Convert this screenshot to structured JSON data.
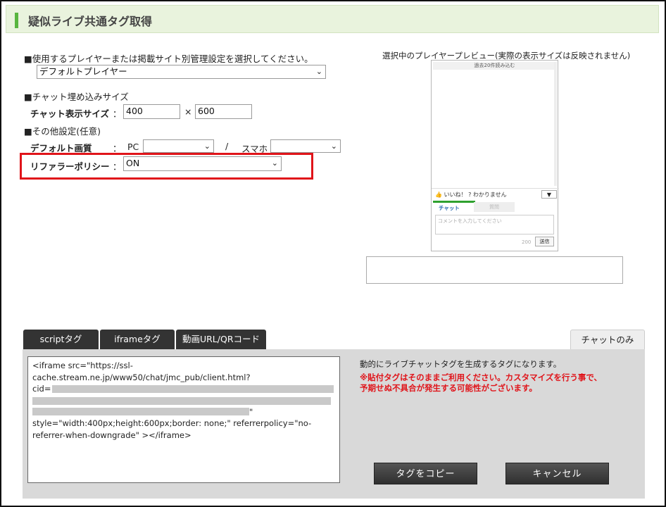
{
  "header": {
    "title": "疑似ライブ共通タグ取得"
  },
  "settings": {
    "player_heading": "■使用するプレイヤーまたは掲載サイト別管理設定を選択してください。",
    "player_select": "デフォルトプレイヤー",
    "chat_size_heading": "■チャット埋め込みサイズ",
    "chat_size_label": "チャット表示サイズ",
    "colon": "：",
    "width_value": "400",
    "times": "×",
    "height_value": "600",
    "other_heading": "■その他設定(任意)",
    "quality_label": "デフォルト画質",
    "pc_label": "PC",
    "pc_select": "",
    "slash": "/",
    "smartphone_label": "スマホ",
    "smartphone_select": "",
    "referrer_label": "リファラーポリシー",
    "referrer_select": "ON"
  },
  "preview": {
    "caption": "選択中のプレイヤープレビュー(実際の表示サイズは反映されません)",
    "load_more": "過去20件読み込む",
    "like": "いいね！",
    "dont_understand": "わかりません",
    "tab_chat": "チャット",
    "tab_question": "質問",
    "comment_placeholder": "コメントを入力してください",
    "char_count": "200",
    "send": "送信"
  },
  "tabs": [
    {
      "label": "scriptタグ"
    },
    {
      "label": "iframeタグ"
    },
    {
      "label": "動画URL/QRコード"
    }
  ],
  "chat_only_tab": "チャットのみ",
  "code": {
    "line1": "<iframe src=\"https://ssl-",
    "line2": "cache.stream.ne.jp/www50/chat/jmc_pub/client.html?",
    "line3": "cid=",
    "quote": "\"",
    "line4": " style=\"width:400px;height:600px;border: none;\" referrerpolicy=\"no-",
    "line5": "referrer-when-downgrade\" ></iframe>"
  },
  "description": "動的にライブチャットタグを生成するタグになります。",
  "warning": {
    "line1": "※貼付タグはそのままご利用ください。カスタマイズを行う事で、",
    "line2": "予期せぬ不具合が発生する可能性がございます。"
  },
  "buttons": {
    "copy": "タグをコピー",
    "cancel": "キャンセル"
  },
  "colors": {
    "accent_green": "#58b53f",
    "highlight_red": "#e0141a",
    "tab_dark": "#333333"
  }
}
